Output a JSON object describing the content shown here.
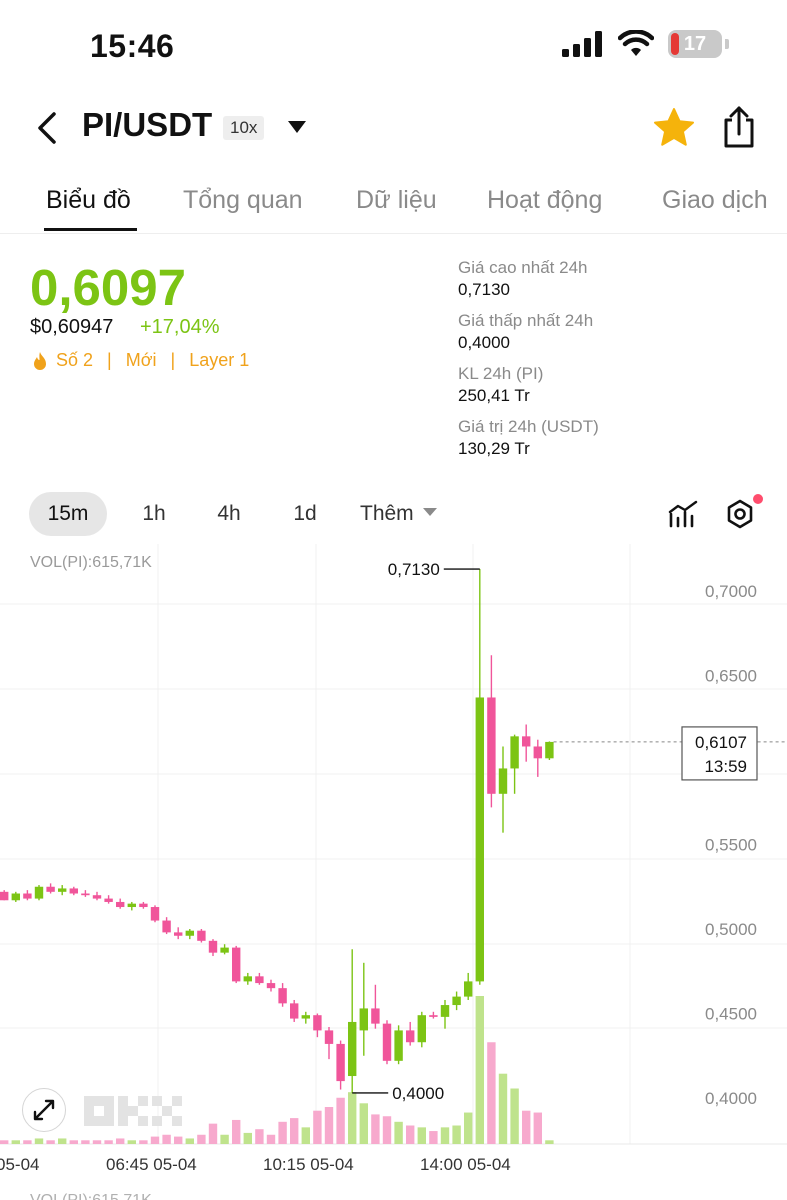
{
  "status_bar": {
    "time": "15:46",
    "battery_level": "17",
    "icons": [
      "signal-icon",
      "wifi-icon",
      "battery-icon"
    ]
  },
  "header": {
    "title": "PI/USDT",
    "leverage": "10x",
    "icons": [
      "back-arrow-icon",
      "dropdown-caret-icon",
      "star-icon",
      "share-icon"
    ],
    "star_color": "#f5b30b"
  },
  "tabs": [
    {
      "label": "Biểu đồ",
      "active": true
    },
    {
      "label": "Tổng quan",
      "active": false
    },
    {
      "label": "Dữ liệu",
      "active": false
    },
    {
      "label": "Hoạt động",
      "active": false
    },
    {
      "label": "Giao dịch",
      "active": false
    }
  ],
  "price": {
    "last": "0,6097",
    "usd": "$0,60947",
    "change": "+17,04%",
    "tags": [
      "Số 2",
      "Mới",
      "Layer 1"
    ],
    "up_color": "#7cc414",
    "tag_color": "#f0a21b"
  },
  "stats": [
    {
      "label": "Giá cao nhất 24h",
      "value": "0,7130"
    },
    {
      "label": "Giá thấp nhất 24h",
      "value": "0,4000"
    },
    {
      "label": "KL 24h (PI)",
      "value": "250,41 Tr"
    },
    {
      "label": "Giá trị 24h (USDT)",
      "value": "130,29 Tr"
    }
  ],
  "intervals": {
    "items": [
      "15m",
      "1h",
      "4h",
      "1d"
    ],
    "active": "15m",
    "more_label": "Thêm"
  },
  "chart_data": {
    "type": "candlestick",
    "volume_label": "VOL(PI):615,71K",
    "y_ticks": [
      "0,7000",
      "0,6500",
      "0,5500",
      "0,5000",
      "0,4500",
      "0,4000"
    ],
    "y_tick_values": [
      0.7,
      0.65,
      0.55,
      0.5,
      0.45,
      0.4
    ],
    "x_ticks": [
      "05-04",
      "06:45 05-04",
      "10:15 05-04",
      "14:00 05-04"
    ],
    "high_annotation": "0,7130",
    "low_annotation": "0,4000",
    "current_price_label": "0,6107",
    "countdown": "13:59",
    "current_price": 0.6107,
    "up_color": "#7cc414",
    "down_color": "#f0559a",
    "candles": [
      {
        "o": 0.522,
        "h": 0.523,
        "l": 0.517,
        "c": 0.517,
        "v": 2
      },
      {
        "o": 0.517,
        "h": 0.522,
        "l": 0.516,
        "c": 0.521,
        "v": 2
      },
      {
        "o": 0.521,
        "h": 0.523,
        "l": 0.517,
        "c": 0.518,
        "v": 2
      },
      {
        "o": 0.518,
        "h": 0.526,
        "l": 0.517,
        "c": 0.525,
        "v": 3
      },
      {
        "o": 0.525,
        "h": 0.527,
        "l": 0.521,
        "c": 0.522,
        "v": 2
      },
      {
        "o": 0.522,
        "h": 0.526,
        "l": 0.52,
        "c": 0.524,
        "v": 3
      },
      {
        "o": 0.524,
        "h": 0.525,
        "l": 0.52,
        "c": 0.521,
        "v": 2
      },
      {
        "o": 0.521,
        "h": 0.523,
        "l": 0.519,
        "c": 0.52,
        "v": 2
      },
      {
        "o": 0.52,
        "h": 0.522,
        "l": 0.517,
        "c": 0.518,
        "v": 2
      },
      {
        "o": 0.518,
        "h": 0.52,
        "l": 0.515,
        "c": 0.516,
        "v": 2
      },
      {
        "o": 0.516,
        "h": 0.518,
        "l": 0.512,
        "c": 0.513,
        "v": 3
      },
      {
        "o": 0.513,
        "h": 0.516,
        "l": 0.511,
        "c": 0.515,
        "v": 2
      },
      {
        "o": 0.515,
        "h": 0.516,
        "l": 0.512,
        "c": 0.513,
        "v": 2
      },
      {
        "o": 0.513,
        "h": 0.514,
        "l": 0.504,
        "c": 0.505,
        "v": 4
      },
      {
        "o": 0.505,
        "h": 0.507,
        "l": 0.497,
        "c": 0.498,
        "v": 5
      },
      {
        "o": 0.498,
        "h": 0.501,
        "l": 0.494,
        "c": 0.496,
        "v": 4
      },
      {
        "o": 0.496,
        "h": 0.5,
        "l": 0.494,
        "c": 0.499,
        "v": 3
      },
      {
        "o": 0.499,
        "h": 0.5,
        "l": 0.492,
        "c": 0.493,
        "v": 5
      },
      {
        "o": 0.493,
        "h": 0.494,
        "l": 0.484,
        "c": 0.486,
        "v": 11
      },
      {
        "o": 0.486,
        "h": 0.491,
        "l": 0.485,
        "c": 0.489,
        "v": 5
      },
      {
        "o": 0.489,
        "h": 0.49,
        "l": 0.468,
        "c": 0.469,
        "v": 13
      },
      {
        "o": 0.469,
        "h": 0.474,
        "l": 0.467,
        "c": 0.472,
        "v": 6
      },
      {
        "o": 0.472,
        "h": 0.474,
        "l": 0.467,
        "c": 0.468,
        "v": 8
      },
      {
        "o": 0.468,
        "h": 0.47,
        "l": 0.463,
        "c": 0.465,
        "v": 5
      },
      {
        "o": 0.465,
        "h": 0.468,
        "l": 0.454,
        "c": 0.456,
        "v": 12
      },
      {
        "o": 0.456,
        "h": 0.458,
        "l": 0.445,
        "c": 0.447,
        "v": 14
      },
      {
        "o": 0.447,
        "h": 0.451,
        "l": 0.444,
        "c": 0.449,
        "v": 9
      },
      {
        "o": 0.449,
        "h": 0.45,
        "l": 0.436,
        "c": 0.44,
        "v": 18
      },
      {
        "o": 0.44,
        "h": 0.442,
        "l": 0.423,
        "c": 0.432,
        "v": 20
      },
      {
        "o": 0.432,
        "h": 0.434,
        "l": 0.405,
        "c": 0.41,
        "v": 25
      },
      {
        "o": 0.413,
        "h": 0.488,
        "l": 0.403,
        "c": 0.445,
        "v": 28
      },
      {
        "o": 0.44,
        "h": 0.48,
        "l": 0.425,
        "c": 0.453,
        "v": 22
      },
      {
        "o": 0.453,
        "h": 0.467,
        "l": 0.441,
        "c": 0.444,
        "v": 16
      },
      {
        "o": 0.444,
        "h": 0.446,
        "l": 0.42,
        "c": 0.422,
        "v": 15
      },
      {
        "o": 0.422,
        "h": 0.443,
        "l": 0.42,
        "c": 0.44,
        "v": 12
      },
      {
        "o": 0.44,
        "h": 0.445,
        "l": 0.431,
        "c": 0.433,
        "v": 10
      },
      {
        "o": 0.433,
        "h": 0.451,
        "l": 0.43,
        "c": 0.449,
        "v": 9
      },
      {
        "o": 0.449,
        "h": 0.451,
        "l": 0.447,
        "c": 0.448,
        "v": 7
      },
      {
        "o": 0.448,
        "h": 0.458,
        "l": 0.441,
        "c": 0.455,
        "v": 9
      },
      {
        "o": 0.455,
        "h": 0.463,
        "l": 0.452,
        "c": 0.46,
        "v": 10
      },
      {
        "o": 0.46,
        "h": 0.474,
        "l": 0.458,
        "c": 0.469,
        "v": 17
      },
      {
        "o": 0.469,
        "h": 0.713,
        "l": 0.467,
        "c": 0.637,
        "v": 80
      },
      {
        "o": 0.637,
        "h": 0.662,
        "l": 0.572,
        "c": 0.58,
        "v": 55
      },
      {
        "o": 0.58,
        "h": 0.608,
        "l": 0.557,
        "c": 0.595,
        "v": 38
      },
      {
        "o": 0.595,
        "h": 0.615,
        "l": 0.58,
        "c": 0.614,
        "v": 30
      },
      {
        "o": 0.614,
        "h": 0.621,
        "l": 0.599,
        "c": 0.608,
        "v": 18
      },
      {
        "o": 0.608,
        "h": 0.612,
        "l": 0.59,
        "c": 0.601,
        "v": 17
      },
      {
        "o": 0.601,
        "h": 0.611,
        "l": 0.6,
        "c": 0.6107,
        "v": 2
      }
    ]
  }
}
